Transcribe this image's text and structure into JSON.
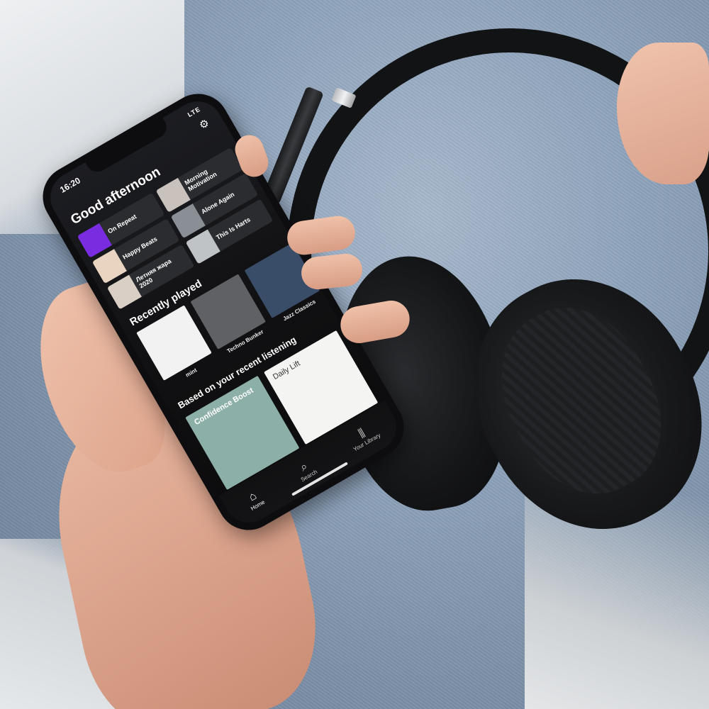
{
  "status": {
    "time": "16:20",
    "network": "LTE"
  },
  "home": {
    "greeting": "Good afternoon",
    "tiles": [
      {
        "title": "On Repeat",
        "color": "#7a2de0"
      },
      {
        "title": "Morning Motivation",
        "color": "#c9c2bc"
      },
      {
        "title": "Happy Beats",
        "color": "#e8d4c0"
      },
      {
        "title": "Alone Again",
        "color": "#8a8f96"
      },
      {
        "title": "Летняя жара 2020",
        "color": "#d9cfc4"
      },
      {
        "title": "This Is Harts",
        "color": "#c0c3c6"
      }
    ],
    "recently_played_title": "Recently played",
    "recently_played": [
      {
        "title": "mint",
        "color": "#f2f2f2"
      },
      {
        "title": "Techno Bunker",
        "color": "#5f6164"
      },
      {
        "title": "Jazz Classics",
        "color": "#3a4d68"
      }
    ],
    "based_title": "Based on your recent listening",
    "based": [
      {
        "title": "Confidence Boost",
        "color": "#8cb0a8"
      },
      {
        "title": "Daily Lift",
        "color": "#f4f4f2"
      },
      {
        "title": "",
        "color": "#f0e3d6"
      }
    ]
  },
  "nav": [
    {
      "label": "Home",
      "icon": "home-icon"
    },
    {
      "label": "Search",
      "icon": "search-icon"
    },
    {
      "label": "Your Library",
      "icon": "library-icon"
    }
  ]
}
